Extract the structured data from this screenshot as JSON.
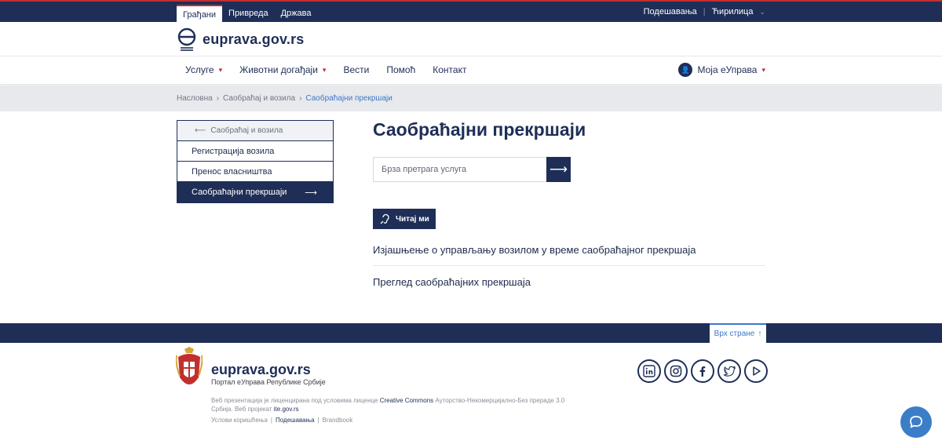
{
  "topbar": {
    "tabs": [
      "Грађани",
      "Привреда",
      "Држава"
    ],
    "settings": "Подешавања",
    "language": "Ћирилица"
  },
  "logo": {
    "text": "euprava.gov.rs"
  },
  "nav": {
    "items": [
      "Услуге",
      "Животни догађаји",
      "Вести",
      "Помоћ",
      "Контакт"
    ],
    "account": "Моја еУправа"
  },
  "breadcrumb": [
    "Насловна",
    "Саобраћај и возила",
    "Саобраћајни прекршаји"
  ],
  "sidemenu": {
    "back": "Саобраћај и возила",
    "links": [
      "Регистрација возила",
      "Пренос власништва",
      "Саобраћајни прекршаји"
    ]
  },
  "main": {
    "title": "Саобраћајни прекршаји",
    "search_placeholder": "Брза претрага услуга",
    "readme": "Читај ми",
    "links": [
      "Изјашњење о управљању возилом у време саобраћајног прекршаја",
      "Преглед саобраћајних прекршаја"
    ]
  },
  "footer": {
    "totop": "Врх стране",
    "brand": "euprava.gov.rs",
    "subtitle": "Портал еУправа Републике Србије",
    "license_1": "Веб презентација је лиценцирана под условима лиценце",
    "license_cc": "Creative Commons",
    "license_2": "Ауторство-Некомерцијално-Без прераде 3.0 Србија. Веб пројекат",
    "license_site": "ite.gov.rs",
    "links": [
      "Услови коришћења",
      "Подешавања",
      "Brandbook"
    ],
    "socials": [
      "in",
      "ig",
      "f",
      "tw",
      "yt"
    ]
  },
  "colors": {
    "primary": "#1e2e57",
    "accent": "#c22f2f",
    "link": "#3d77c9"
  }
}
